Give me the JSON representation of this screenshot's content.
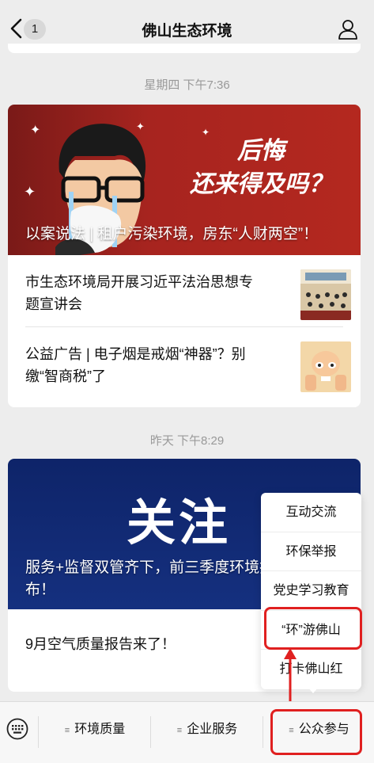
{
  "header": {
    "title": "佛山生态环境",
    "badge_count": "1"
  },
  "timeline": [
    {
      "timestamp": "星期四 下午7:36",
      "cover": {
        "headline": "后悔\n还来得及吗？",
        "title": "以案说法 | 租户污染环境，房东“人财两空”！"
      },
      "items": [
        {
          "title": "市生态环境局开展习近平法治思想专题宣讲会"
        },
        {
          "title": "公益广告 | 电子烟是戒烟“神器”？别缴“智商税”了"
        }
      ]
    },
    {
      "timestamp": "昨天 下午8:29",
      "cover": {
        "headline": "关注",
        "title": "服务+监督双管齐下，前三季度环境执法情况公布！"
      },
      "items": [
        {
          "title": "9月空气质量报告来了！"
        }
      ]
    }
  ],
  "popup_menu": {
    "items": [
      "互动交流",
      "环保举报",
      "党史学习教育",
      "“环”游佛山",
      "打卡佛山红"
    ]
  },
  "bottom_bar": {
    "tabs": [
      "环境质量",
      "企业服务",
      "公众参与"
    ]
  }
}
